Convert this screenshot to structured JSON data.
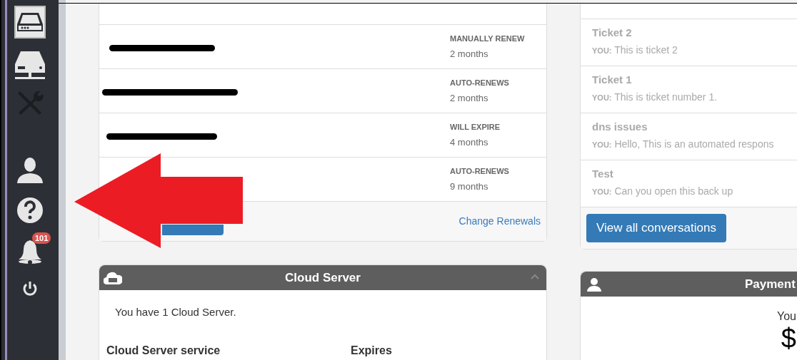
{
  "sidebar": {
    "items": [
      {
        "kind": "server",
        "selected": true,
        "disabled": false
      },
      {
        "kind": "network",
        "selected": false,
        "disabled": false
      },
      {
        "kind": "tools",
        "selected": false,
        "disabled": true
      },
      {
        "kind": "user",
        "selected": false,
        "disabled": false
      },
      {
        "kind": "help",
        "selected": false,
        "disabled": false
      },
      {
        "kind": "bell",
        "selected": false,
        "disabled": false,
        "badge": "101"
      },
      {
        "kind": "power",
        "selected": false,
        "disabled": false
      }
    ]
  },
  "domains": {
    "rows": [
      {
        "status": "MANUALLY RENEW",
        "term": "2 months"
      },
      {
        "status": "AUTO-RENEWS",
        "term": "2 months"
      },
      {
        "status": "WILL EXPIRE",
        "term": "4 months"
      },
      {
        "status": "AUTO-RENEWS",
        "term": "9 months"
      }
    ],
    "link": "Change Renewals"
  },
  "tickets": {
    "items": [
      {
        "title": "Ticket 2",
        "author": "YOU:",
        "message": "This is ticket 2"
      },
      {
        "title": "Ticket 1",
        "author": "YOU:",
        "message": "This is ticket number 1."
      },
      {
        "title": "dns issues",
        "author": "YOU:",
        "message": "Hello, This is an automated respons"
      },
      {
        "title": "Test",
        "author": "YOU:",
        "message": "Can you open this back up"
      }
    ],
    "button": "View all conversations"
  },
  "cloud_server": {
    "title": "Cloud Server",
    "summary": "You have 1 Cloud Server.",
    "columns": [
      "Cloud Server service",
      "Expires"
    ]
  },
  "payment": {
    "title": "Payment",
    "line_1": "You",
    "amount": "$"
  }
}
